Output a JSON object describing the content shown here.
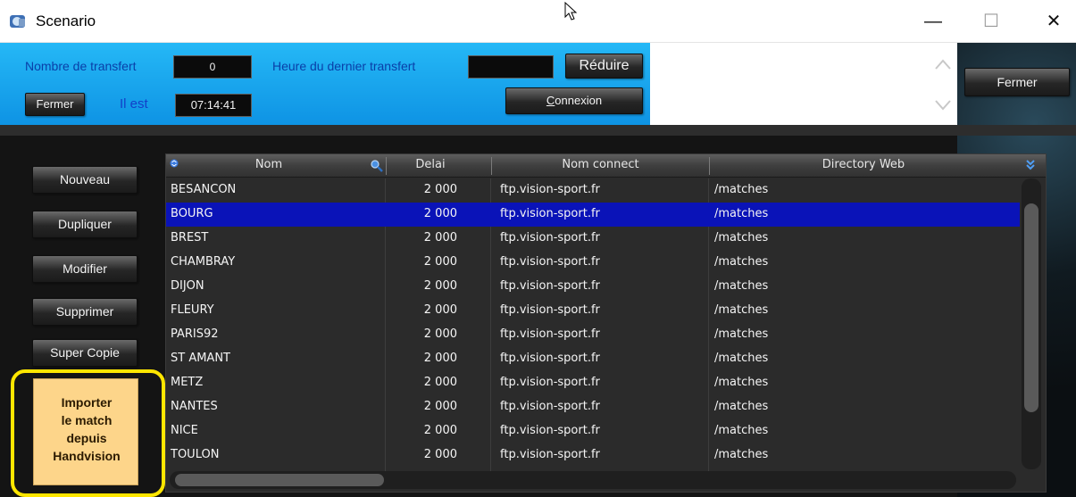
{
  "window": {
    "title": "Scenario",
    "min_glyph": "—",
    "max_glyph": "☐",
    "close_glyph": "✕",
    "icon": "app-icon"
  },
  "toppanel": {
    "nombre_label": "Nombre de transfert",
    "nombre_value": "0",
    "heure_label": "Heure du dernier transfert",
    "heure_value": "",
    "reduire_label": "Réduire",
    "fermer_label": "Fermer",
    "il_est_label": "Il est",
    "time_value": "07:14:41",
    "connexion_label": "Connexion"
  },
  "right": {
    "fermer_label": "Fermer"
  },
  "sidebar": {
    "buttons": [
      {
        "label": "Nouveau"
      },
      {
        "label": "Dupliquer"
      },
      {
        "label": "Modifier"
      },
      {
        "label": "Supprimer"
      },
      {
        "label": "Super Copie"
      }
    ],
    "import_label": "Importer\nle match\ndepuis\nHandvision"
  },
  "grid": {
    "columns": [
      "Nom",
      "Delai",
      "Nom connect",
      "Directory Web"
    ],
    "selected_row": 1,
    "rows": [
      {
        "nom": "BESANCON",
        "delai": "2 000",
        "connect": "ftp.vision-sport.fr",
        "dir": "/matches"
      },
      {
        "nom": "BOURG",
        "delai": "2 000",
        "connect": "ftp.vision-sport.fr",
        "dir": "/matches"
      },
      {
        "nom": "BREST",
        "delai": "2 000",
        "connect": "ftp.vision-sport.fr",
        "dir": "/matches"
      },
      {
        "nom": "CHAMBRAY",
        "delai": "2 000",
        "connect": "ftp.vision-sport.fr",
        "dir": "/matches"
      },
      {
        "nom": "DIJON",
        "delai": "2 000",
        "connect": "ftp.vision-sport.fr",
        "dir": "/matches"
      },
      {
        "nom": "FLEURY",
        "delai": "2 000",
        "connect": "ftp.vision-sport.fr",
        "dir": "/matches"
      },
      {
        "nom": "PARIS92",
        "delai": "2 000",
        "connect": "ftp.vision-sport.fr",
        "dir": "/matches"
      },
      {
        "nom": "ST AMANT",
        "delai": "2 000",
        "connect": "ftp.vision-sport.fr",
        "dir": "/matches"
      },
      {
        "nom": "METZ",
        "delai": "2 000",
        "connect": "ftp.vision-sport.fr",
        "dir": "/matches"
      },
      {
        "nom": "NANTES",
        "delai": "2 000",
        "connect": "ftp.vision-sport.fr",
        "dir": "/matches"
      },
      {
        "nom": "NICE",
        "delai": "2 000",
        "connect": "ftp.vision-sport.fr",
        "dir": "/matches"
      },
      {
        "nom": "TOULON",
        "delai": "2 000",
        "connect": "ftp.vision-sport.fr",
        "dir": "/matches"
      }
    ]
  },
  "colors": {
    "panel_blue": "#1aa5ee",
    "label_blue": "#0a3fa8",
    "selection": "#0a13b8",
    "highlight_ring": "#ffe600",
    "import_bg": "#fdd58a"
  }
}
